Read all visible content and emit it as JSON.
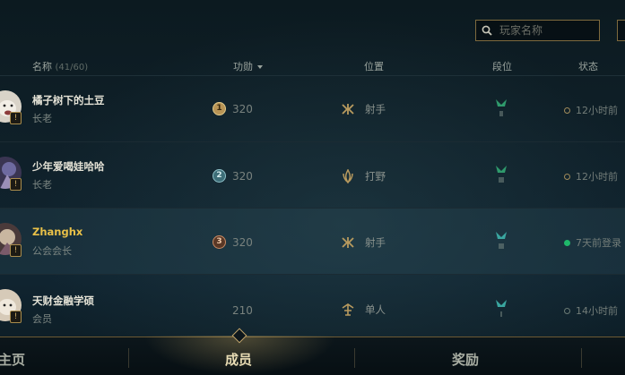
{
  "search": {
    "placeholder": "玩家名称"
  },
  "header": {
    "name": "名称",
    "count": "(41/60)",
    "honor": "功勋",
    "position": "位置",
    "tier": "段位",
    "status": "状态"
  },
  "members": [
    {
      "name": "橘子树下的土豆",
      "rank": "长老",
      "honor_rank": "1",
      "honor": "320",
      "position": "射手",
      "status": "12小时前",
      "online": false
    },
    {
      "name": "少年爱喝娃哈哈",
      "rank": "长老",
      "honor_rank": "2",
      "honor": "320",
      "position": "打野",
      "status": "12小时前",
      "online": false
    },
    {
      "name": "Zhanghx",
      "rank": "公会会长",
      "honor_rank": "3",
      "honor": "320",
      "position": "射手",
      "status": "7天前登录",
      "online": true
    },
    {
      "name": "天财金融学硕",
      "rank": "会员",
      "honor_rank": "",
      "honor": "210",
      "position": "单人",
      "status": "14小时前",
      "online": false
    }
  ],
  "nav": {
    "home": "主页",
    "members": "成员",
    "rewards": "奖励"
  },
  "colors": {
    "accent_gold": "#c8aa6e",
    "online_green": "#1fb86a",
    "leader_name": "#e8c048"
  }
}
